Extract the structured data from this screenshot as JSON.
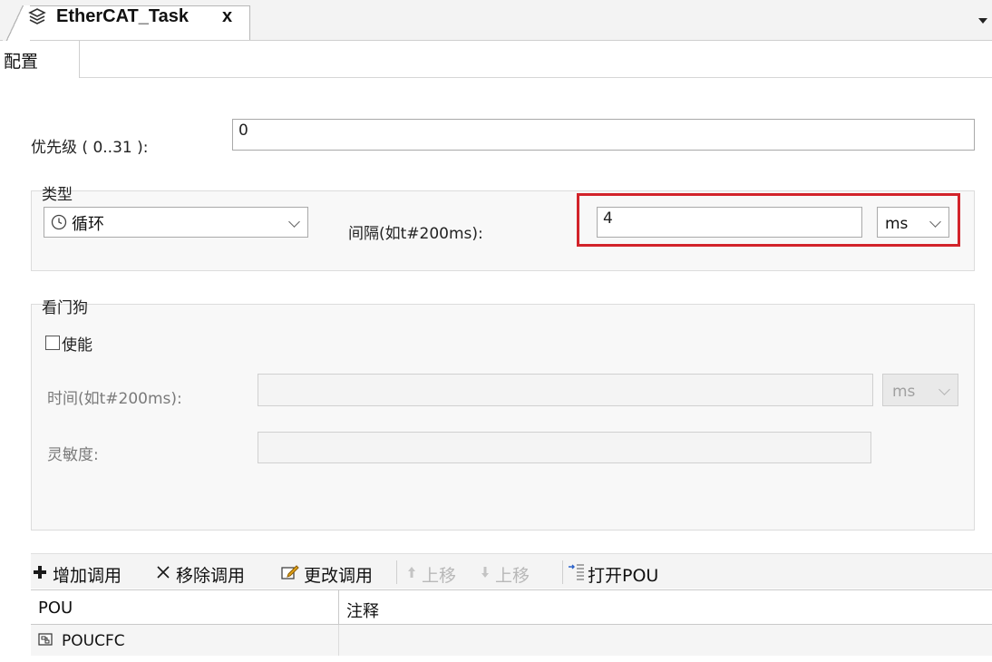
{
  "tab": {
    "title": "EtherCAT_Task",
    "close": "x"
  },
  "subtab": {
    "label": "配置"
  },
  "priority": {
    "label": "优先级 ( 0..31 ):",
    "value": "0"
  },
  "type_group": {
    "legend": "类型",
    "type_value": "循环",
    "interval_label": "间隔(如t#200ms):",
    "interval_value": "4",
    "interval_unit": "ms"
  },
  "watchdog_group": {
    "legend": "看门狗",
    "enable_label": "使能",
    "enable_checked": false,
    "time_label": "时间(如t#200ms):",
    "time_value": "",
    "time_unit": "ms",
    "sensitivity_label": "灵敏度:",
    "sensitivity_value": ""
  },
  "toolbar": {
    "add_call": "增加调用",
    "remove_call": "移除调用",
    "change_call": "更改调用",
    "move_up": "上移",
    "move_down": "上移",
    "open_pou": "打开POU"
  },
  "table": {
    "headers": [
      "POU",
      "注释"
    ],
    "rows": [
      {
        "pou": "POUCFC",
        "comment": ""
      }
    ]
  },
  "colors": {
    "highlight": "#d2232a",
    "group_bg": "#f8f8f8",
    "toolbar_bg": "#f4f4f4"
  },
  "icons": [
    "task-icon",
    "clock-icon",
    "plus-icon",
    "remove-x-icon",
    "edit-icon",
    "arrow-up-icon",
    "arrow-down-icon",
    "open-pou-icon",
    "pou-cfc-icon"
  ]
}
